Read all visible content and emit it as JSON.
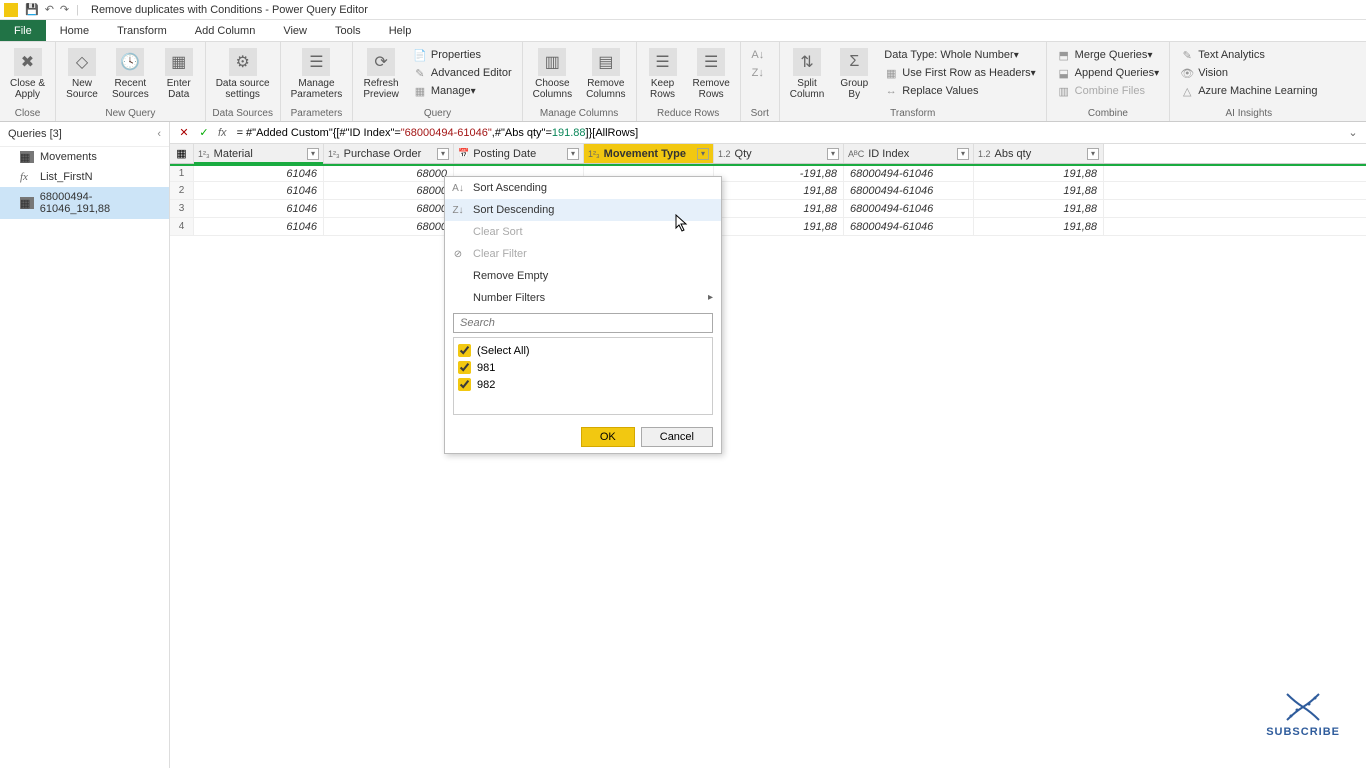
{
  "window": {
    "title": "Remove duplicates with Conditions - Power Query Editor"
  },
  "tabs": {
    "file": "File",
    "home": "Home",
    "transform": "Transform",
    "add_column": "Add Column",
    "view": "View",
    "tools": "Tools",
    "help": "Help"
  },
  "ribbon": {
    "close": {
      "big": "Close &\nApply",
      "label": "Close"
    },
    "new_query": {
      "new_source": "New\nSource",
      "recent": "Recent\nSources",
      "enter": "Enter\nData",
      "label": "New Query"
    },
    "data_sources": {
      "settings": "Data source\nsettings",
      "label": "Data Sources"
    },
    "parameters": {
      "manage": "Manage\nParameters",
      "label": "Parameters"
    },
    "query": {
      "refresh": "Refresh\nPreview",
      "properties": "Properties",
      "advanced": "Advanced Editor",
      "manage": "Manage",
      "label": "Query"
    },
    "manage_columns": {
      "choose": "Choose\nColumns",
      "remove": "Remove\nColumns",
      "label": "Manage Columns"
    },
    "reduce_rows": {
      "keep": "Keep\nRows",
      "remove": "Remove\nRows",
      "label": "Reduce Rows"
    },
    "sort": {
      "label": "Sort"
    },
    "transform": {
      "split": "Split\nColumn",
      "group": "Group\nBy",
      "datatype": "Data Type: Whole Number",
      "first_row": "Use First Row as Headers",
      "replace": "Replace Values",
      "label": "Transform"
    },
    "combine": {
      "merge": "Merge Queries",
      "append": "Append Queries",
      "files": "Combine Files",
      "label": "Combine"
    },
    "ai": {
      "text": "Text Analytics",
      "vision": "Vision",
      "ml": "Azure Machine Learning",
      "label": "AI Insights"
    }
  },
  "formula": {
    "text_pre": "= #\"Added Custom\"{[#\"ID Index\"=",
    "str1": "\"68000494-61046\"",
    "mid": ",#\"Abs qty\"=",
    "num1": "191.88",
    "post": "]}[AllRows]"
  },
  "queries": {
    "header": "Queries [3]",
    "items": [
      {
        "name": "Movements",
        "kind": "table"
      },
      {
        "name": "List_FirstN",
        "kind": "fx"
      },
      {
        "name": "68000494-61046_191,88",
        "kind": "table",
        "selected": true
      }
    ]
  },
  "columns": [
    {
      "name": "Material",
      "type": "1²₃"
    },
    {
      "name": "Purchase Order",
      "type": "1²₃"
    },
    {
      "name": "Posting Date",
      "type": "📅"
    },
    {
      "name": "Movement Type",
      "type": "1²₃",
      "active": true
    },
    {
      "name": "Qty",
      "type": "1.2"
    },
    {
      "name": "ID Index",
      "type": "AᴮC"
    },
    {
      "name": "Abs qty",
      "type": "1.2"
    }
  ],
  "rows": [
    {
      "n": 1,
      "material": "61046",
      "po": "68000",
      "qty": "-191,88",
      "id": "68000494-61046",
      "abs": "191,88"
    },
    {
      "n": 2,
      "material": "61046",
      "po": "68000",
      "qty": "191,88",
      "id": "68000494-61046",
      "abs": "191,88"
    },
    {
      "n": 3,
      "material": "61046",
      "po": "68000",
      "qty": "191,88",
      "id": "68000494-61046",
      "abs": "191,88"
    },
    {
      "n": 4,
      "material": "61046",
      "po": "68000",
      "qty": "191,88",
      "id": "68000494-61046",
      "abs": "191,88"
    }
  ],
  "filter": {
    "sort_asc": "Sort Ascending",
    "sort_desc": "Sort Descending",
    "clear_sort": "Clear Sort",
    "clear_filter": "Clear Filter",
    "remove_empty": "Remove Empty",
    "number_filters": "Number Filters",
    "search_placeholder": "Search",
    "select_all": "(Select All)",
    "values": [
      "981",
      "982"
    ],
    "ok": "OK",
    "cancel": "Cancel"
  },
  "subscribe": "SUBSCRIBE"
}
